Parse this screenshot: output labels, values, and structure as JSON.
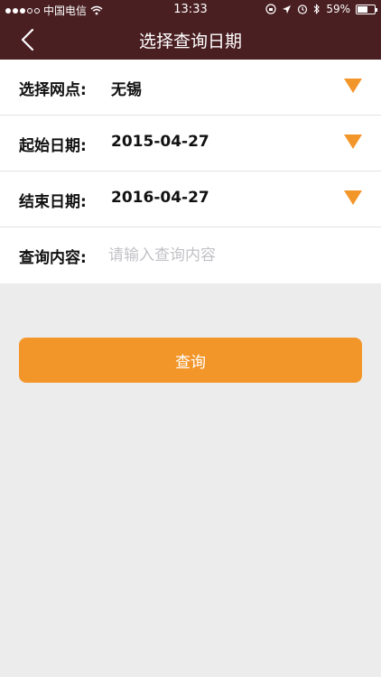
{
  "status_bar": {
    "carrier": "中国电信",
    "time": "13:33",
    "battery": "59%",
    "battery_level": 0.59
  },
  "nav": {
    "title": "选择查询日期",
    "back_icon": "chevron-left-icon"
  },
  "form": {
    "branch": {
      "label": "选择网点:",
      "value": "无锡"
    },
    "start_date": {
      "label": "起始日期:",
      "value": "2015-04-27"
    },
    "end_date": {
      "label": "结束日期:",
      "value": "2016-04-27"
    },
    "query_content": {
      "label": "查询内容:",
      "value": "",
      "placeholder": "请输入查询内容"
    }
  },
  "query_button": {
    "label": "查询"
  },
  "colors": {
    "header_bg": "#4a1f22",
    "accent": "#f3962a",
    "page_bg": "#ececec"
  }
}
